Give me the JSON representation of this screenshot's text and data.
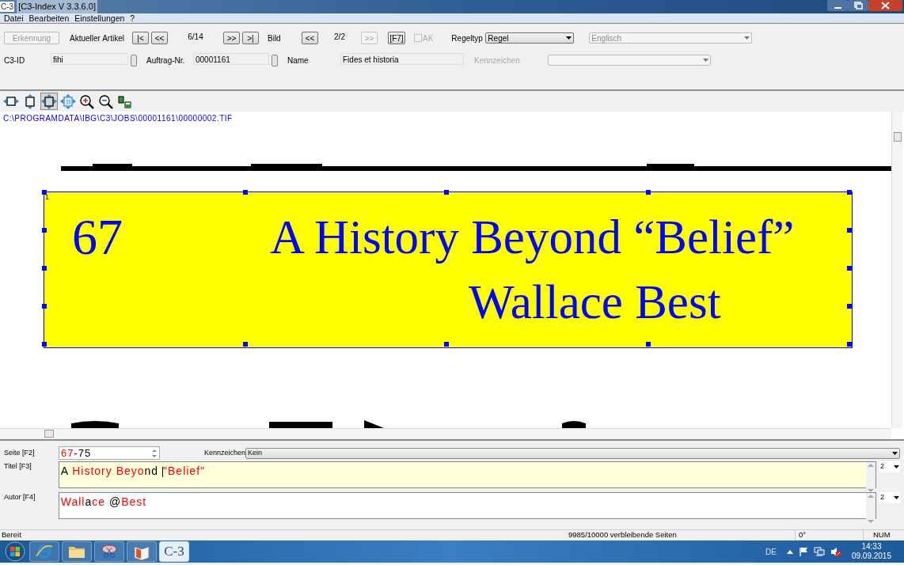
{
  "window": {
    "title": "[C3-Index V 3.3.6.0]",
    "app_badge": "C-3"
  },
  "menu": [
    "Datei",
    "Bearbeiten",
    "Einstellungen",
    "?"
  ],
  "toolbar": {
    "recognize": {
      "label": "Erkennung",
      "disabled": true
    },
    "article": {
      "label": "Aktueller Artikel",
      "first": "|<",
      "prev": "<<",
      "counter": "6/14",
      "next": ">>",
      "last": ">|"
    },
    "image_nav": {
      "label": "Bild",
      "prev": {
        "label": "<<",
        "disabled": false
      },
      "counter": "2/2",
      "next": {
        "label": ">>",
        "disabled": true
      }
    },
    "f7_button": "[F7]",
    "ak_checkbox": {
      "label": "AK",
      "checked": false,
      "disabled": true
    },
    "rule_type": {
      "label": "Regeltyp",
      "value": "Regel"
    },
    "language": {
      "value": "Englisch",
      "disabled": true
    },
    "c3_id": {
      "label": "C3-ID",
      "value": "fihi"
    },
    "order_no": {
      "label": "Auftrag-Nr.",
      "value": "00001161"
    },
    "name": {
      "label": "Name",
      "value": "Fides et historia"
    },
    "flag": {
      "label": "Kennzeichen",
      "disabled": true
    }
  },
  "viewer_tools": [
    {
      "kind": "fit-width",
      "selected": false
    },
    {
      "kind": "fit-height",
      "selected": false
    },
    {
      "kind": "fit-page",
      "selected": true
    },
    {
      "kind": "actual-size",
      "selected": false
    },
    {
      "kind": "zoom-in",
      "selected": false
    },
    {
      "kind": "zoom-out",
      "selected": false
    },
    {
      "kind": "swap",
      "selected": false
    }
  ],
  "viewer": {
    "path": "C:\\PROGRAMDATA\\IBG\\C3\\JOBS\\00001161\\00000002.TIF",
    "selection_marker": "1",
    "page_number": "67",
    "title_line": "A History Beyond “Belief”",
    "author_line": "Wallace Best"
  },
  "form": {
    "page": {
      "label": "Seite [F2]",
      "segments": [
        {
          "text": "67",
          "color": "#ff0000"
        },
        {
          "text": "-75",
          "color": "#000000"
        }
      ]
    },
    "flag": {
      "label": "Kennzeichen",
      "value": "Kein"
    },
    "title": {
      "label": "Titel [F3]",
      "count": "2",
      "segments": [
        {
          "text": "A ",
          "color": "#000000"
        },
        {
          "text": "History Beyo",
          "color": "#ff0000"
        },
        {
          "text": "nd ",
          "color": "#000000"
        },
        {
          "kind": "caret"
        },
        {
          "text": "\"Belief\"",
          "color": "#ff0000"
        }
      ]
    },
    "author": {
      "label": "Autor [F4]",
      "count": "2",
      "segments": [
        {
          "text": "Wall",
          "color": "#ff0000"
        },
        {
          "text": "a",
          "color": "#000000"
        },
        {
          "text": "ce ",
          "color": "#ff0000"
        },
        {
          "text": "@",
          "color": "#000000"
        },
        {
          "text": "Best",
          "color": "#ff0000"
        }
      ]
    }
  },
  "status_bar": [
    "Bereit",
    "9985/10000 verbleibende Seiten",
    "0°",
    "NUM"
  ],
  "taskbar": {
    "apps": [
      {
        "kind": "browser",
        "selected": false
      },
      {
        "kind": "folder",
        "selected": false
      },
      {
        "kind": "scissors",
        "selected": false
      },
      {
        "kind": "book",
        "selected": false
      },
      {
        "kind": "c3",
        "label": "C-3",
        "selected": true
      }
    ],
    "tray": {
      "language": "DE",
      "time": "14:33",
      "date": "09.09.2015"
    }
  }
}
